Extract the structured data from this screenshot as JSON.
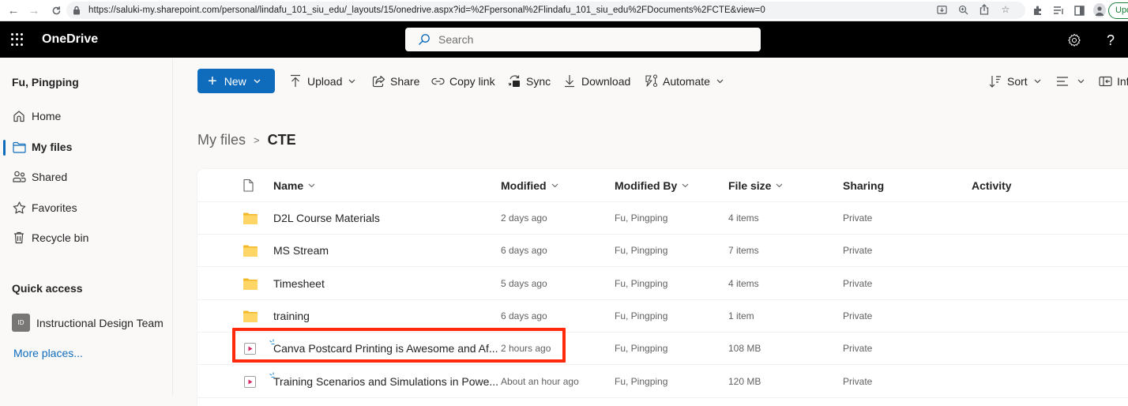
{
  "browser": {
    "url": "https://saluki-my.sharepoint.com/personal/lindafu_101_siu_edu/_layouts/15/onedrive.aspx?id=%2Fpersonal%2Flindafu_101_siu_edu%2FDocuments%2FCTE&view=0",
    "update_label": "Update",
    "icons": [
      "back-icon",
      "forward-icon",
      "reload-icon",
      "lock-icon",
      "install-icon",
      "zoom-icon",
      "share-icon",
      "bookmark-star-icon",
      "extensions-icon",
      "reading-list-icon",
      "side-panel-icon",
      "profile-icon"
    ]
  },
  "app": {
    "title": "OneDrive",
    "search_placeholder": "Search"
  },
  "sidebar": {
    "user_name": "Fu, Pingping",
    "items": [
      {
        "label": "Home",
        "icon": "home-icon",
        "active": false
      },
      {
        "label": "My files",
        "icon": "folder-icon",
        "active": true
      },
      {
        "label": "Shared",
        "icon": "people-icon",
        "active": false
      },
      {
        "label": "Favorites",
        "icon": "star-icon",
        "active": false
      },
      {
        "label": "Recycle bin",
        "icon": "trash-icon",
        "active": false
      }
    ],
    "quick_access_title": "Quick access",
    "quick_access": [
      {
        "badge": "ID",
        "label": "Instructional Design Team"
      }
    ],
    "more_places": "More places..."
  },
  "toolbar": {
    "new_label": "New",
    "upload_label": "Upload",
    "share_label": "Share",
    "copy_link_label": "Copy link",
    "sync_label": "Sync",
    "download_label": "Download",
    "automate_label": "Automate",
    "sort_label": "Sort",
    "info_label": "Info"
  },
  "breadcrumb": {
    "parent": "My files",
    "current": "CTE"
  },
  "file_list": {
    "columns": {
      "name": "Name",
      "modified": "Modified",
      "modified_by": "Modified By",
      "file_size": "File size",
      "sharing": "Sharing",
      "activity": "Activity"
    },
    "rows": [
      {
        "type": "folder",
        "name": "D2L Course Materials",
        "modified": "2 days ago",
        "modified_by": "Fu, Pingping",
        "size": "4 items",
        "sharing": "Private"
      },
      {
        "type": "folder",
        "name": "MS Stream",
        "modified": "6 days ago",
        "modified_by": "Fu, Pingping",
        "size": "7 items",
        "sharing": "Private"
      },
      {
        "type": "folder",
        "name": "Timesheet",
        "modified": "5 days ago",
        "modified_by": "Fu, Pingping",
        "size": "4 items",
        "sharing": "Private"
      },
      {
        "type": "folder",
        "name": "training",
        "modified": "6 days ago",
        "modified_by": "Fu, Pingping",
        "size": "1 item",
        "sharing": "Private"
      },
      {
        "type": "video",
        "name": "Canva Postcard Printing is Awesome and Af...",
        "modified": "2 hours ago",
        "modified_by": "Fu, Pingping",
        "size": "108 MB",
        "sharing": "Private",
        "new": true,
        "highlighted": true
      },
      {
        "type": "video",
        "name": "Training Scenarios and Simulations in Powe...",
        "modified": "About an hour ago",
        "modified_by": "Fu, Pingping",
        "size": "120 MB",
        "sharing": "Private",
        "new": true
      }
    ]
  },
  "colors": {
    "accent": "#0f6cbd",
    "highlight": "#ff2a0c",
    "folder": "#ffd566",
    "video": "#d6275f"
  }
}
